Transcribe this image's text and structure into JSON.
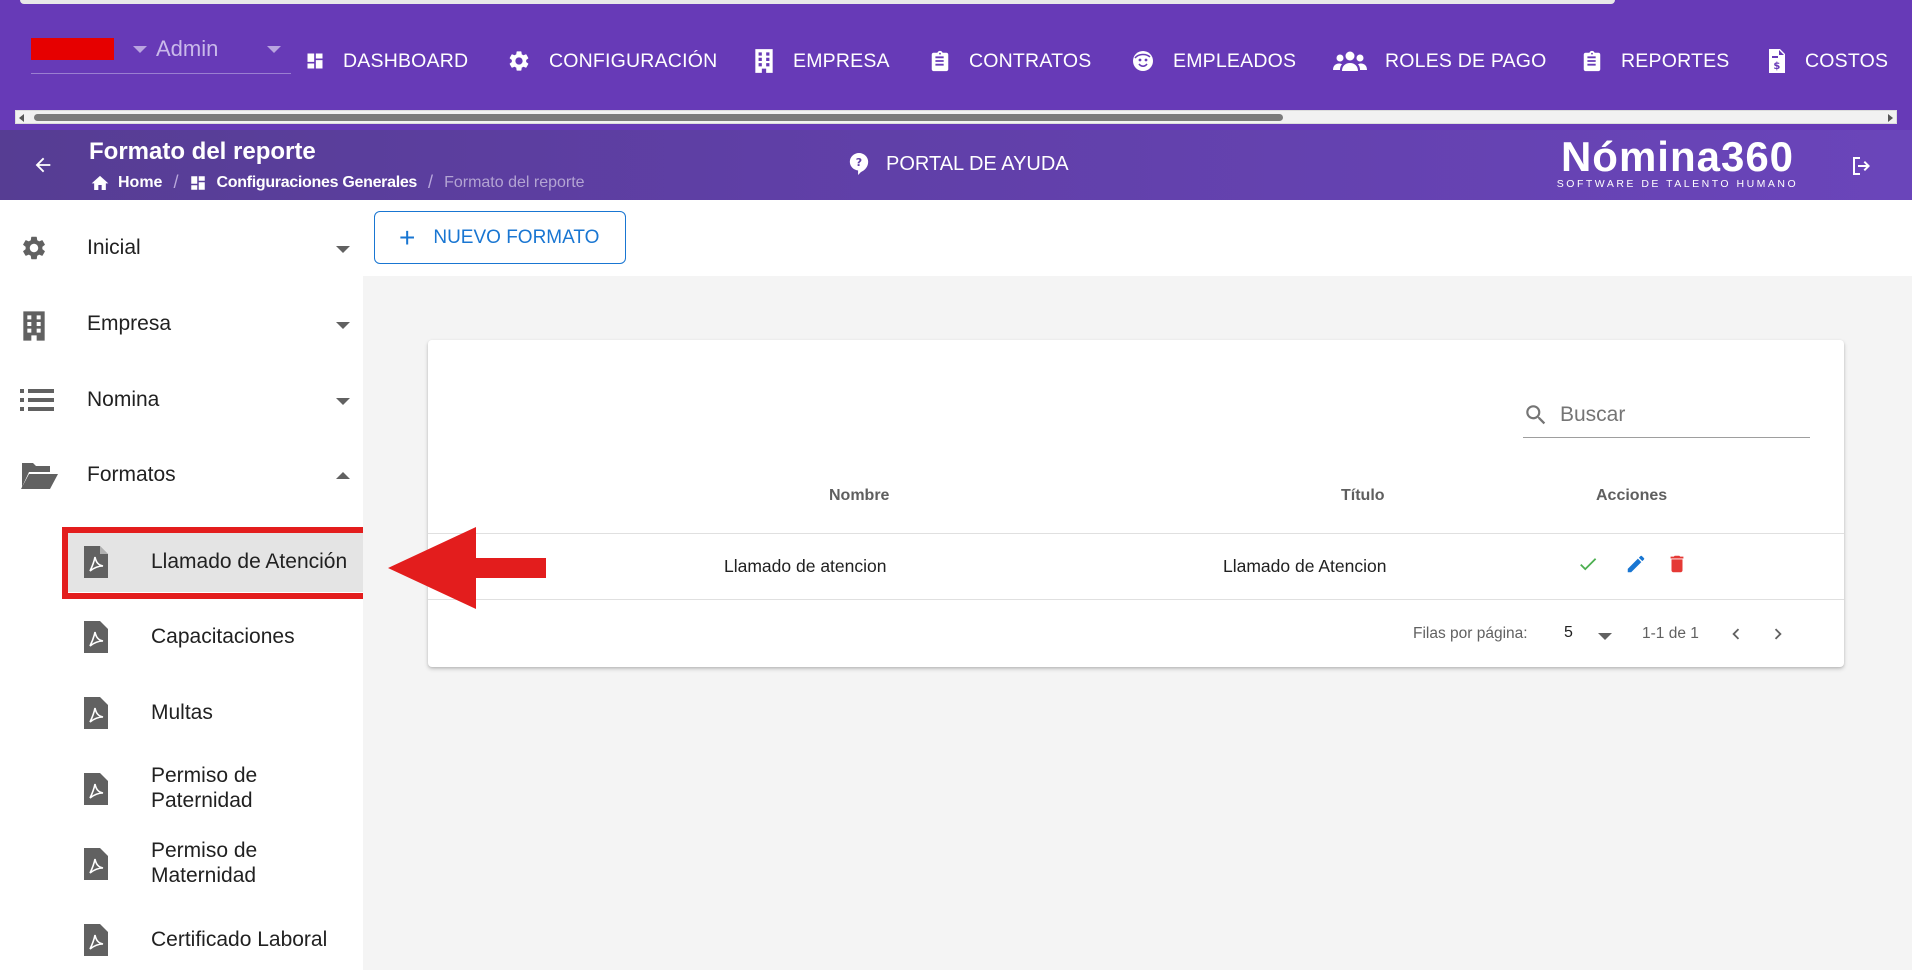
{
  "topbar": {
    "user_label": "Admin",
    "nav": [
      {
        "label": "DASHBOARD",
        "icon": "dashboard-icon"
      },
      {
        "label": "CONFIGURACIÓN",
        "icon": "gear-icon"
      },
      {
        "label": "EMPRESA",
        "icon": "building-icon"
      },
      {
        "label": "CONTRATOS",
        "icon": "clipboard-icon"
      },
      {
        "label": "EMPLEADOS",
        "icon": "face-icon"
      },
      {
        "label": "ROLES DE PAGO",
        "icon": "people-icon"
      },
      {
        "label": "REPORTES",
        "icon": "clipboard-icon"
      },
      {
        "label": "COSTOS",
        "icon": "invoice-dollar-icon"
      }
    ]
  },
  "header": {
    "title": "Formato del reporte",
    "breadcrumb": [
      "Home",
      "Configuraciones Generales",
      "Formato del reporte"
    ],
    "help_label": "PORTAL DE AYUDA",
    "brand_name": "Nómina360",
    "brand_tagline": "SOFTWARE DE TALENTO HUMANO"
  },
  "sidebar": {
    "items": [
      {
        "label": "Inicial",
        "icon": "gear-icon"
      },
      {
        "label": "Empresa",
        "icon": "building-icon"
      },
      {
        "label": "Nomina",
        "icon": "list-icon"
      },
      {
        "label": "Formatos",
        "icon": "folder-open-icon"
      }
    ],
    "subitems": [
      {
        "label": "Llamado de Atención",
        "icon": "pdf-file-icon",
        "active": true
      },
      {
        "label": "Capacitaciones",
        "icon": "pdf-file-icon"
      },
      {
        "label": "Multas",
        "icon": "pdf-file-icon"
      },
      {
        "label": "Permiso de Paternidad",
        "icon": "pdf-file-icon"
      },
      {
        "label": "Permiso de Maternidad",
        "icon": "pdf-file-icon"
      },
      {
        "label": "Certificado Laboral",
        "icon": "pdf-file-icon"
      }
    ]
  },
  "main": {
    "new_button_label": "NUEVO FORMATO",
    "search_placeholder": "Buscar",
    "table": {
      "columns": [
        "Nombre",
        "Título",
        "Acciones"
      ],
      "rows": [
        {
          "nombre": "Llamado de atencion",
          "titulo": "Llamado de Atencion"
        }
      ]
    },
    "footer": {
      "rows_per_page_label": "Filas por página:",
      "rows_per_page_value": "5",
      "range_label": "1-1 de 1"
    }
  },
  "colors": {
    "topbar": "#673ab7",
    "accent_blue": "#1976d2",
    "success_green": "#4caf50",
    "danger_red": "#e53935",
    "highlight_red": "#e31d1d"
  }
}
